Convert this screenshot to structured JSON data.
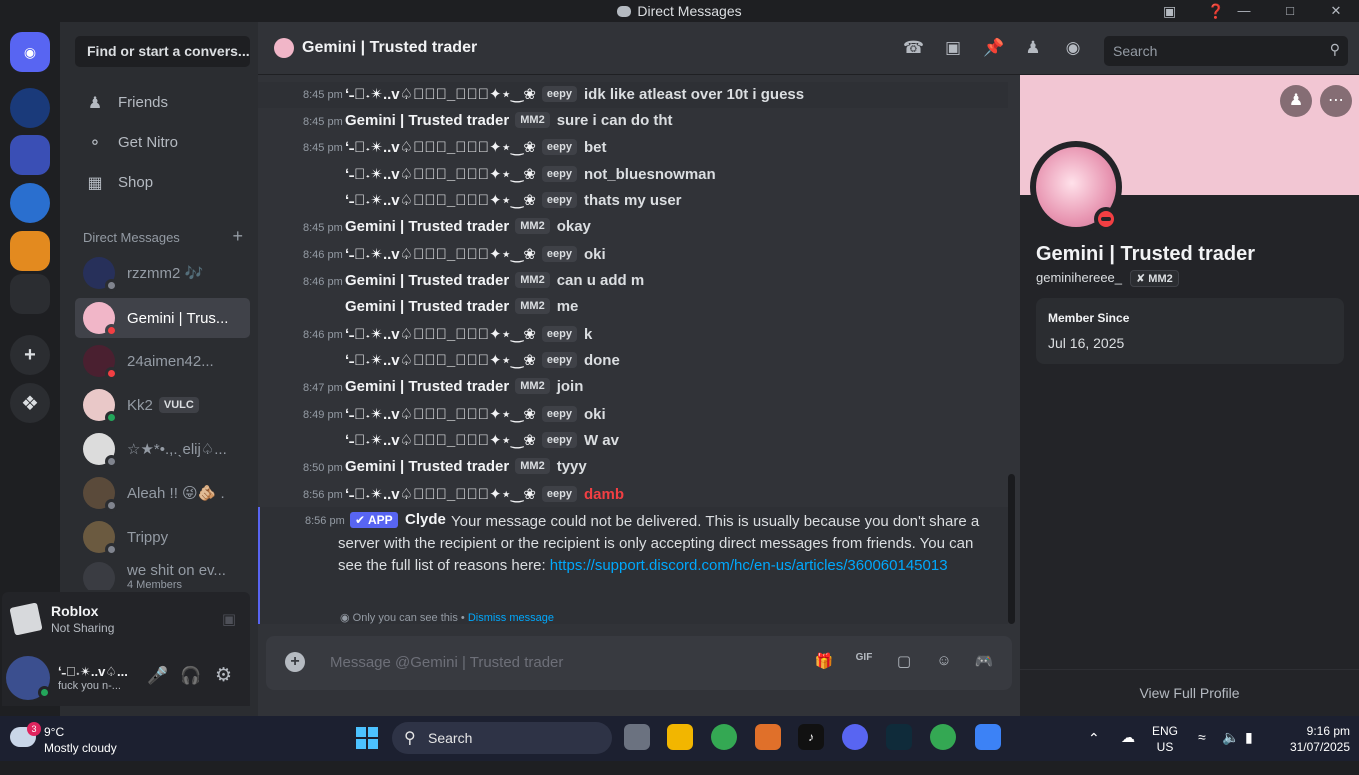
{
  "window": {
    "title": "Direct Messages"
  },
  "sidebar": {
    "find_placeholder": "Find or start a convers...",
    "nav": [
      "Friends",
      "Get Nitro",
      "Shop"
    ],
    "dm_header": "Direct Messages",
    "dms": [
      {
        "name": "rzzmm2 🎶"
      },
      {
        "name": "Gemini | Trus..."
      },
      {
        "name": "24aimen42..."
      },
      {
        "name": "Kk2",
        "badge": "VULC"
      },
      {
        "name": "☆★*•.,.ˎelij♤..."
      },
      {
        "name": "Aleah !! 😜🫵🏼 ."
      },
      {
        "name": "Trippy"
      },
      {
        "name": "we shit on ev...",
        "sub": "4 Members"
      }
    ],
    "activity": {
      "title": "Roblox",
      "status": "Not Sharing"
    },
    "user": {
      "name": "ʻ˗॑˖✴..ᴠ♤...",
      "status": "fuck you n-..."
    }
  },
  "chat": {
    "recipient": "Gemini | Trusted trader",
    "search_placeholder": "Search",
    "messages": [
      {
        "time": "8:45 pm",
        "author": "ʻ˗॑˖✴..ᴠ♤𝔫𝔫𝔶_𝔟𝔬𝔦✦⋆‿❀",
        "tag": "eepy",
        "text": "idk like atleast over 10t i guess"
      },
      {
        "time": "8:45 pm",
        "author": "Gemini | Trusted trader",
        "tag": "MM2",
        "text": "sure i can do tht"
      },
      {
        "time": "8:45 pm",
        "author": "ʻ˗॑˖✴..ᴠ♤𝔫𝔫𝔶_𝔟𝔬𝔦✦⋆‿❀",
        "tag": "eepy",
        "text": "bet"
      },
      {
        "time": "",
        "author": "ʻ˗॑˖✴..ᴠ♤𝔫𝔫𝔶_𝔟𝔬𝔦✦⋆‿❀",
        "tag": "eepy",
        "text": "not_bluesnowman"
      },
      {
        "time": "",
        "author": "ʻ˗॑˖✴..ᴠ♤𝔫𝔫𝔶_𝔟𝔬𝔦✦⋆‿❀",
        "tag": "eepy",
        "text": "thats my user"
      },
      {
        "time": "8:45 pm",
        "author": "Gemini | Trusted trader",
        "tag": "MM2",
        "text": "okay"
      },
      {
        "time": "8:46 pm",
        "author": "ʻ˗॑˖✴..ᴠ♤𝔫𝔫𝔶_𝔟𝔬𝔦✦⋆‿❀",
        "tag": "eepy",
        "text": "oki"
      },
      {
        "time": "8:46 pm",
        "author": "Gemini | Trusted trader",
        "tag": "MM2",
        "text": "can u add m"
      },
      {
        "time": "",
        "author": "Gemini | Trusted trader",
        "tag": "MM2",
        "text": "me"
      },
      {
        "time": "8:46 pm",
        "author": "ʻ˗॑˖✴..ᴠ♤𝔫𝔫𝔶_𝔟𝔬𝔦✦⋆‿❀",
        "tag": "eepy",
        "text": "k"
      },
      {
        "time": "",
        "author": "ʻ˗॑˖✴..ᴠ♤𝔫𝔫𝔶_𝔟𝔬𝔦✦⋆‿❀",
        "tag": "eepy",
        "text": "done"
      },
      {
        "time": "8:47 pm",
        "author": "Gemini | Trusted trader",
        "tag": "MM2",
        "text": "join"
      },
      {
        "time": "8:49 pm",
        "author": "ʻ˗॑˖✴..ᴠ♤𝔫𝔫𝔶_𝔟𝔬𝔦✦⋆‿❀",
        "tag": "eepy",
        "text": "oki"
      },
      {
        "time": "",
        "author": "ʻ˗॑˖✴..ᴠ♤𝔫𝔫𝔶_𝔟𝔬𝔦✦⋆‿❀",
        "tag": "eepy",
        "text": "W av"
      },
      {
        "time": "8:50 pm",
        "author": "Gemini | Trusted trader",
        "tag": "MM2",
        "text": "tyyy"
      },
      {
        "time": "8:56 pm",
        "author": "ʻ˗॑˖✴..ᴠ♤𝔫𝔫𝔶_𝔟𝔬𝔦✦⋆‿❀",
        "tag": "eepy",
        "text": "damb",
        "failed": true
      }
    ],
    "system": {
      "time": "8:56 pm",
      "app_tag": "✔ APP",
      "author": "Clyde",
      "text": "Your message could not be delivered. This is usually because you don't share a server with the recipient or the recipient is only accepting direct messages from friends. You can see the full list of reasons here:",
      "link": "https://support.discord.com/hc/en-us/articles/360060145013",
      "ephemeral": "Only you can see this •",
      "dismiss": "Dismiss message"
    },
    "composer_placeholder": "Message @Gemini | Trusted trader"
  },
  "profile": {
    "display_name": "Gemini | Trusted trader",
    "username": "geminihereee_",
    "tag": "MM2",
    "member_since_label": "Member Since",
    "member_since": "Jul 16, 2025",
    "view_full": "View Full Profile"
  },
  "taskbar": {
    "weather_temp": "9°C",
    "weather_desc": "Mostly cloudy",
    "weather_badge": "3",
    "search": "Search",
    "lang1": "ENG",
    "lang2": "US",
    "time": "9:16 pm",
    "date": "31/07/2025"
  },
  "colors": {
    "accent": "#5865f2",
    "dnd": "#f23f43",
    "link": "#00a8fc",
    "failed": "#f23f43"
  }
}
